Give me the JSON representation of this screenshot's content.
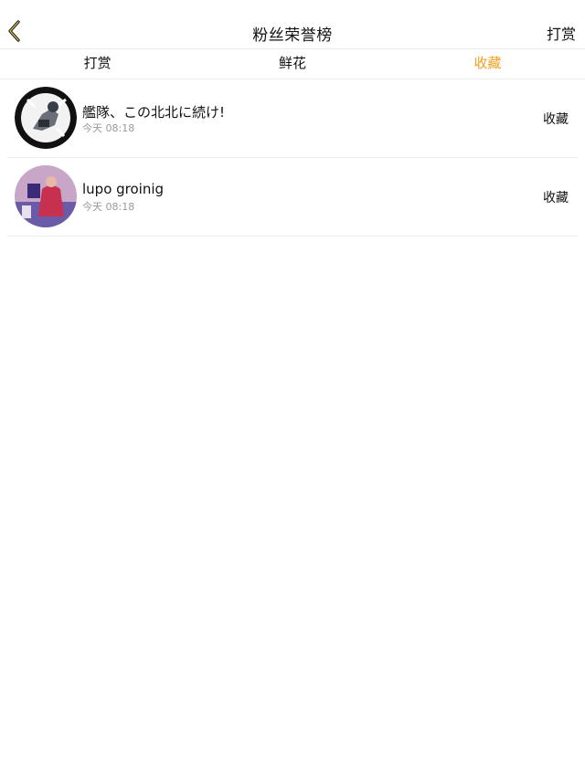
{
  "nav": {
    "title": "粉丝荣誉榜",
    "right_label": "打赏",
    "back_icon": "chevron-left-icon",
    "accent_color": "#f0a020"
  },
  "tabs": [
    {
      "label": "打赏",
      "active": false
    },
    {
      "label": "鲜花",
      "active": false
    },
    {
      "label": "收藏",
      "active": true
    }
  ],
  "items": [
    {
      "name": "艦隊、この北北に続け!",
      "time": "今天 08:18",
      "action": "收藏"
    },
    {
      "name": "lupo groinig",
      "time": "今天 08:18",
      "action": "收藏"
    }
  ]
}
